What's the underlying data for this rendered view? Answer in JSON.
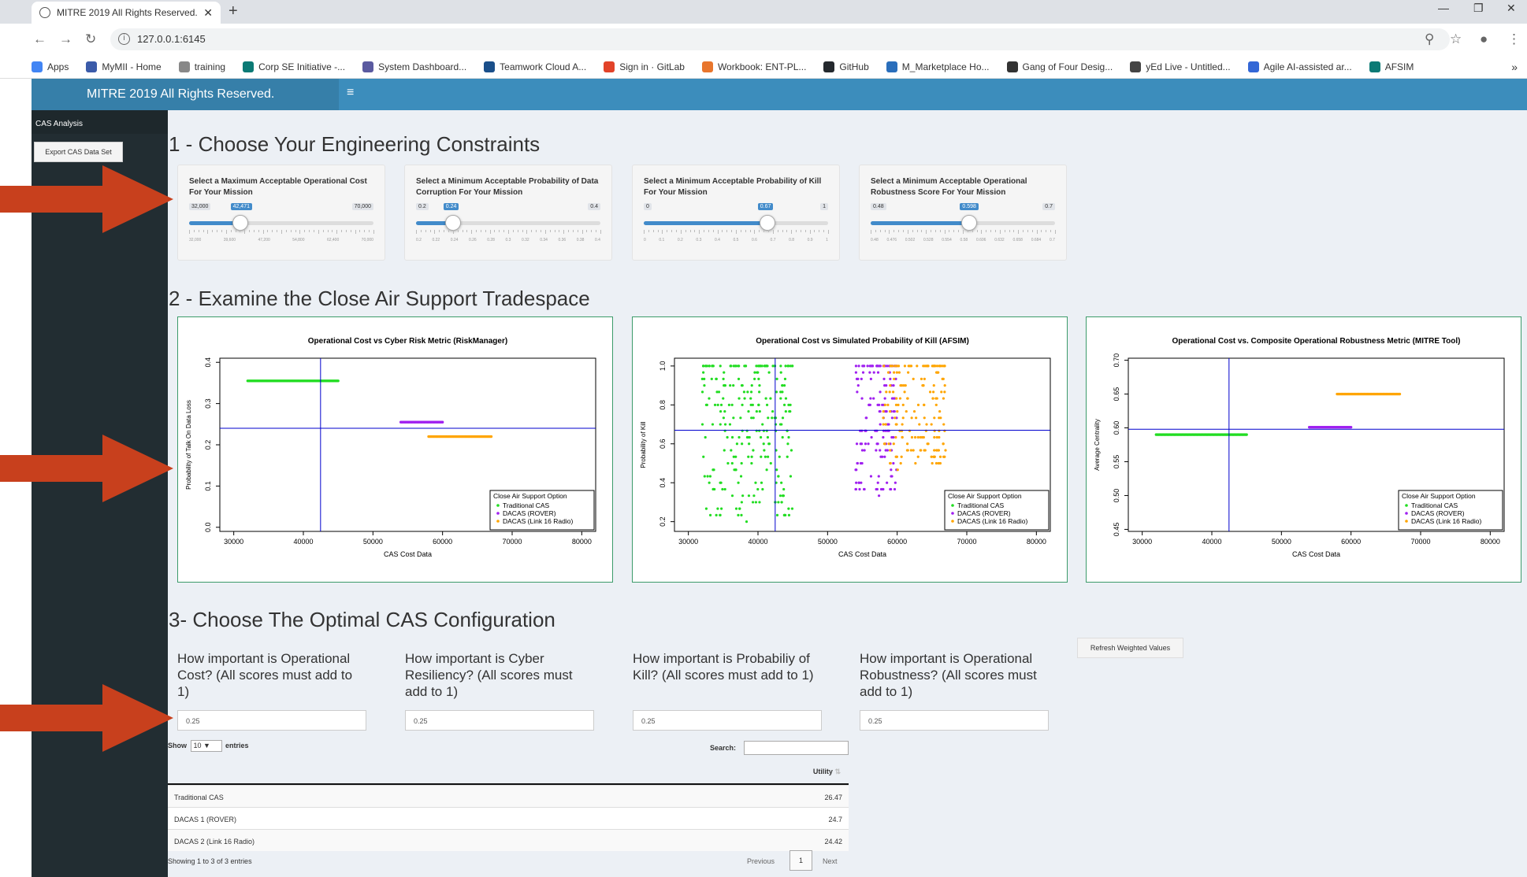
{
  "browser": {
    "tab_title": "MITRE 2019 All Rights Reserved.",
    "url": "127.0.0.1:6145",
    "bookmarks": [
      {
        "label": "Apps",
        "icon": "apps-grid-icon",
        "color": "#4285f4"
      },
      {
        "label": "MyMII - Home",
        "icon": "mymii-icon",
        "color": "#3b5ba9"
      },
      {
        "label": "training",
        "icon": "training-icon",
        "color": "#888888"
      },
      {
        "label": "Corp SE Initiative -...",
        "icon": "sharepoint-icon",
        "color": "#0b7a75"
      },
      {
        "label": "System Dashboard...",
        "icon": "jira-icon",
        "color": "#5a5aa0"
      },
      {
        "label": "Teamwork Cloud A...",
        "icon": "teamwork-icon",
        "color": "#1a4f8a"
      },
      {
        "label": "Sign in · GitLab",
        "icon": "gitlab-icon",
        "color": "#e24329"
      },
      {
        "label": "Workbook: ENT-PL...",
        "icon": "tableau-icon",
        "color": "#e8762d"
      },
      {
        "label": "GitHub",
        "icon": "github-icon",
        "color": "#24292e"
      },
      {
        "label": "M_Marketplace Ho...",
        "icon": "marketplace-icon",
        "color": "#2a6ebb"
      },
      {
        "label": "Gang of Four Desig...",
        "icon": "gof-icon",
        "color": "#333333"
      },
      {
        "label": "yEd Live - Untitled...",
        "icon": "yed-icon",
        "color": "#444444"
      },
      {
        "label": "Agile AI-assisted ar...",
        "icon": "agile-icon",
        "color": "#3367d6"
      },
      {
        "label": "AFSIM",
        "icon": "afsim-icon",
        "color": "#0b7a75"
      }
    ]
  },
  "app": {
    "header_title": "MITRE 2019 All Rights Reserved.",
    "sidebar_item": "CAS Analysis",
    "export_button": "Export CAS Data Set",
    "section1_title": "1 - Choose Your Engineering Constraints",
    "section2_title": "2 - Examine the Close Air Support Tradespace",
    "section3_title": "3- Choose The Optimal CAS Configuration",
    "colors": {
      "header": "#3c8dbc",
      "logo": "#367fa9",
      "sidebar": "#222d32",
      "content_bg": "#ecf0f5",
      "arrow": "#c8401d",
      "plot_border": "#3c9b6a"
    }
  },
  "sliders": [
    {
      "label": "Select a Maximum Acceptable Operational Cost For Your Mission",
      "min": "32,000",
      "max": "70,000",
      "value": "42,471",
      "fraction": 0.276,
      "ticks": [
        "32,000",
        "39,600",
        "47,200",
        "54,800",
        "62,400",
        "70,000"
      ]
    },
    {
      "label": "Select a Minimum Acceptable Probability of Data Corruption For Your Mission",
      "min": "0.2",
      "max": "0.4",
      "value": "0.24",
      "fraction": 0.2,
      "ticks": [
        "0.2",
        "0.22",
        "0.24",
        "0.26",
        "0.28",
        "0.3",
        "0.32",
        "0.34",
        "0.36",
        "0.38",
        "0.4"
      ]
    },
    {
      "label": "Select a Minimum Acceptable Probability of Kill For Your Mission",
      "min": "0",
      "max": "1",
      "value": "0.67",
      "fraction": 0.67,
      "ticks": [
        "0",
        "0.1",
        "0.2",
        "0.3",
        "0.4",
        "0.5",
        "0.6",
        "0.7",
        "0.8",
        "0.9",
        "1"
      ]
    },
    {
      "label": "Select a Minimum Acceptable Operational Robustness Score For Your Mission",
      "min": "0.48",
      "max": "0.7",
      "value": "0.598",
      "fraction": 0.536,
      "ticks": [
        "0.48",
        "0.476",
        "0.502",
        "0.528",
        "0.554",
        "0.58",
        "0.606",
        "0.632",
        "0.658",
        "0.684",
        "0.7"
      ]
    }
  ],
  "chart_data": [
    {
      "type": "scatter",
      "title": "Operational Cost vs Cyber Risk Metric (RiskManager)",
      "xlabel": "CAS Cost Data",
      "ylabel": "Probability of Talk On Data Loss",
      "xlim": [
        28000,
        82000
      ],
      "ylim": [
        -0.01,
        0.41
      ],
      "xticks": [
        "30000",
        "40000",
        "50000",
        "60000",
        "70000",
        "80000"
      ],
      "yticks": [
        "0.0",
        "0.1",
        "0.2",
        "0.3",
        "0.4"
      ],
      "ytick_values": [
        0,
        0.1,
        0.2,
        0.3,
        0.4
      ],
      "xtick_values": [
        30000,
        40000,
        50000,
        60000,
        70000,
        80000
      ],
      "vline": 42471,
      "hline": 0.24,
      "legend_title": "Close Air Support Option",
      "legend_position": "bottom-right",
      "series": [
        {
          "name": "Traditional CAS",
          "color": "#22dd22",
          "segment": [
            32000,
            45000
          ],
          "y": 0.355
        },
        {
          "name": "DACAS (ROVER)",
          "color": "#a020f0",
          "segment": [
            54000,
            60000
          ],
          "y": 0.255
        },
        {
          "name": "DACAS (Link 16 Radio)",
          "color": "#ffa500",
          "segment": [
            58000,
            67000
          ],
          "y": 0.22
        }
      ]
    },
    {
      "type": "scatter",
      "title": "Operational Cost vs Simulated Probability of Kill (AFSIM)",
      "xlabel": "CAS Cost Data",
      "ylabel": "Probability of Kill",
      "xlim": [
        28000,
        82000
      ],
      "ylim": [
        0.15,
        1.04
      ],
      "xticks": [
        "30000",
        "40000",
        "50000",
        "60000",
        "70000",
        "80000"
      ],
      "yticks": [
        "0.2",
        "0.4",
        "0.6",
        "0.8",
        "1.0"
      ],
      "ytick_values": [
        0.2,
        0.4,
        0.6,
        0.8,
        1.0
      ],
      "xtick_values": [
        30000,
        40000,
        50000,
        60000,
        70000,
        80000
      ],
      "vline": 42471,
      "hline": 0.67,
      "legend_title": "Close Air Support Option",
      "legend_position": "bottom-right",
      "series": [
        {
          "name": "Traditional CAS",
          "color": "#22dd22",
          "xrange": [
            32000,
            45000
          ],
          "yrange": [
            0.2,
            1.0
          ],
          "n": 260
        },
        {
          "name": "DACAS (ROVER)",
          "color": "#a020f0",
          "xrange": [
            54000,
            60000
          ],
          "yrange": [
            0.33,
            1.0
          ],
          "n": 150
        },
        {
          "name": "DACAS (Link 16 Radio)",
          "color": "#ffa500",
          "xrange": [
            58000,
            67000
          ],
          "yrange": [
            0.48,
            1.0
          ],
          "n": 170
        }
      ]
    },
    {
      "type": "scatter",
      "title": "Operational Cost vs. Composite Operational Robustness Metric (MITRE Tool)",
      "xlabel": "CAS Cost Data",
      "ylabel": "Average Centrality",
      "xlim": [
        28000,
        82000
      ],
      "ylim": [
        0.447,
        0.703
      ],
      "xticks": [
        "30000",
        "40000",
        "50000",
        "60000",
        "70000",
        "80000"
      ],
      "yticks": [
        "0.45",
        "0.50",
        "0.55",
        "0.60",
        "0.65",
        "0.70"
      ],
      "ytick_values": [
        0.45,
        0.5,
        0.55,
        0.6,
        0.65,
        0.7
      ],
      "xtick_values": [
        30000,
        40000,
        50000,
        60000,
        70000,
        80000
      ],
      "vline": 42471,
      "hline": 0.598,
      "legend_title": "Close Air Support Option",
      "legend_position": "bottom-right",
      "series": [
        {
          "name": "Traditional CAS",
          "color": "#22dd22",
          "segment": [
            32000,
            45000
          ],
          "y": 0.59
        },
        {
          "name": "DACAS (ROVER)",
          "color": "#a020f0",
          "segment": [
            54000,
            60000
          ],
          "y": 0.601
        },
        {
          "name": "DACAS (Link 16 Radio)",
          "color": "#ffa500",
          "segment": [
            58000,
            67000
          ],
          "y": 0.65
        }
      ]
    }
  ],
  "weights": [
    {
      "label": "How important is Operational Cost? (All scores must add to 1)",
      "value": "0.25"
    },
    {
      "label": "How important is Cyber Resiliency? (All scores must add to 1)",
      "value": "0.25"
    },
    {
      "label": "How important is Probabiliy of Kill? (All scores must add to 1)",
      "value": "0.25"
    },
    {
      "label": "How important is Operational Robustness? (All scores must add to 1)",
      "value": "0.25"
    }
  ],
  "refresh_button": "Refresh Weighted Values",
  "table": {
    "show_label": "Show",
    "show_value": "10",
    "entries_label": "entries",
    "search_label": "Search:",
    "column_header": "Utility",
    "rows": [
      {
        "name": "Traditional CAS",
        "utility": "26.47"
      },
      {
        "name": "DACAS 1 (ROVER)",
        "utility": "24.7"
      },
      {
        "name": "DACAS 2 (Link 16 Radio)",
        "utility": "24.42"
      }
    ],
    "info": "Showing 1 to 3 of 3 entries",
    "previous": "Previous",
    "page": "1",
    "next": "Next"
  }
}
